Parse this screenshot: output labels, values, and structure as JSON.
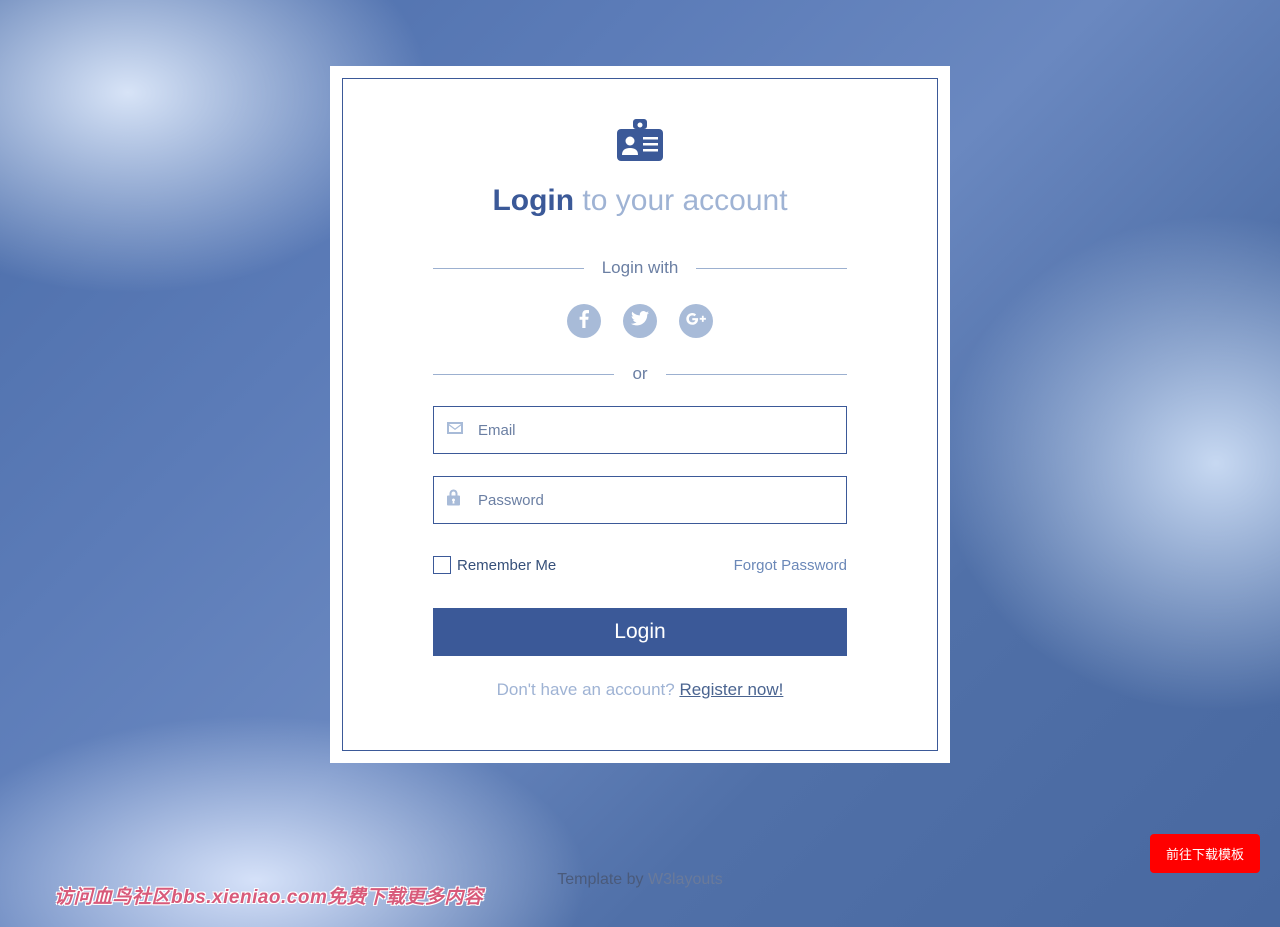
{
  "heading": {
    "bold": "Login",
    "rest": " to your account"
  },
  "dividers": {
    "login_with": "Login with",
    "or": "or"
  },
  "social": {
    "facebook": "facebook-icon",
    "twitter": "twitter-icon",
    "google": "google-plus-icon"
  },
  "inputs": {
    "email": {
      "placeholder": "Email",
      "value": ""
    },
    "password": {
      "placeholder": "Password",
      "value": ""
    }
  },
  "options": {
    "remember": "Remember Me",
    "forgot": "Forgot Password"
  },
  "login_button": "Login",
  "register": {
    "prompt": "Don't have an account? ",
    "link": "Register now!"
  },
  "footer": {
    "prefix": "Template by ",
    "credit": "W3layouts"
  },
  "download_button": "前往下载模板",
  "watermark": "访问血鸟社区bbs.xieniao.com免费下载更多内容"
}
